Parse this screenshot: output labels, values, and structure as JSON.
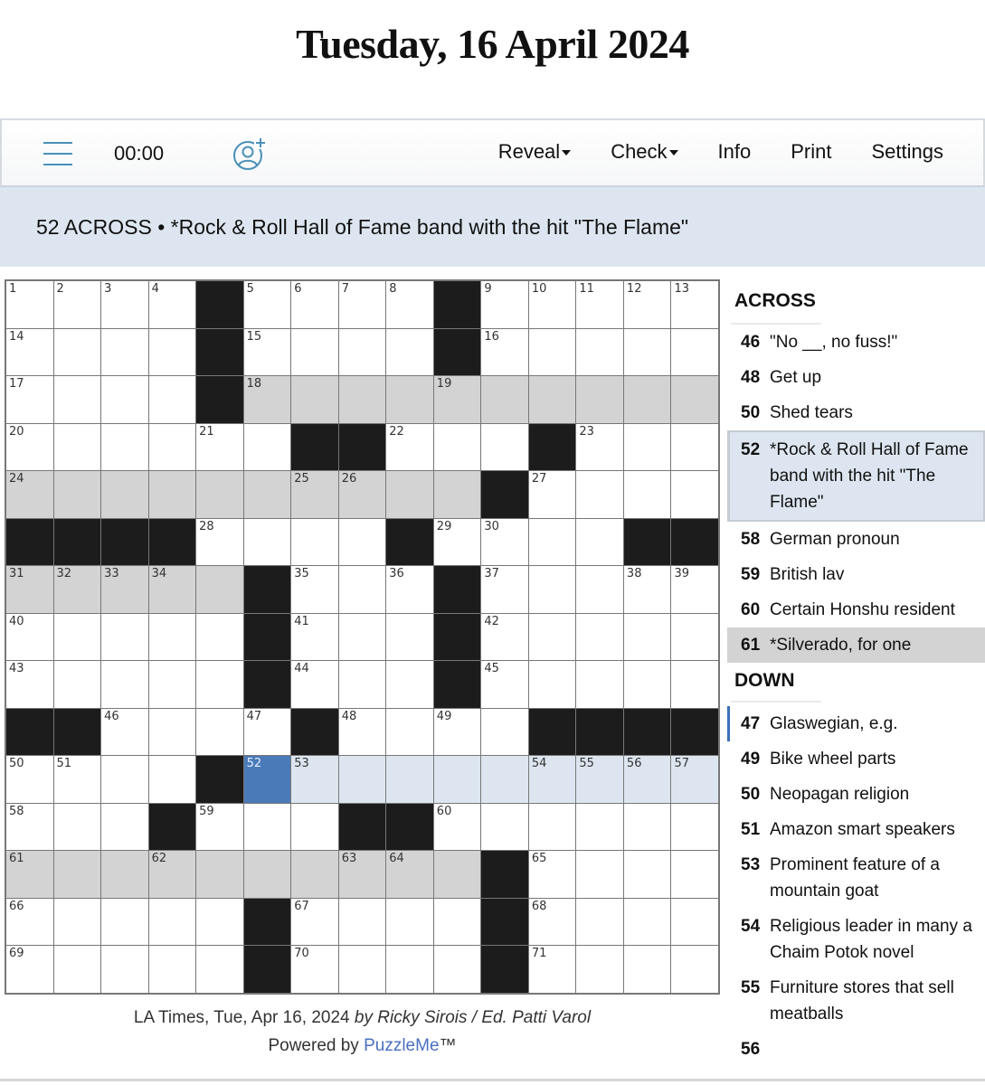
{
  "page": {
    "title": "Tuesday, 16 April 2024"
  },
  "toolbar": {
    "timer": "00:00",
    "menu": [
      {
        "label": "Reveal",
        "dropdown": true
      },
      {
        "label": "Check",
        "dropdown": true
      },
      {
        "label": "Info",
        "dropdown": false
      },
      {
        "label": "Print",
        "dropdown": false
      },
      {
        "label": "Settings",
        "dropdown": false
      }
    ],
    "icons": {
      "menu": "hamburger-icon",
      "add_player": "add-user-icon"
    }
  },
  "current_clue": {
    "text": "52 ACROSS • *Rock & Roll Hall of Fame band with the hit \"The Flame\""
  },
  "grid": {
    "size": 15,
    "selected_cell": "52",
    "rows": [
      "....#....#.....",
      "....#....#.....",
      "....#gggggggggg",
      "......##...#...",
      "gggggggggg#....",
      "####....#....##",
      "ggggg#...#.....",
      ".....#...#.....",
      ".....#...#.....",
      "##....#....####",
      "....#sbbbbbbbbb",
      "...#...##......",
      "gggggggggg#....",
      ".....#....#....",
      ".....#....#...."
    ],
    "legend": {
      "#": "black",
      ".": "empty",
      "g": "theme-highlight",
      "b": "current-word",
      "s": "selected"
    },
    "numbers": [
      [
        0,
        0,
        1
      ],
      [
        0,
        1,
        2
      ],
      [
        0,
        2,
        3
      ],
      [
        0,
        3,
        4
      ],
      [
        0,
        5,
        5
      ],
      [
        0,
        6,
        6
      ],
      [
        0,
        7,
        7
      ],
      [
        0,
        8,
        8
      ],
      [
        0,
        10,
        9
      ],
      [
        0,
        11,
        10
      ],
      [
        0,
        12,
        11
      ],
      [
        0,
        13,
        12
      ],
      [
        0,
        14,
        13
      ],
      [
        1,
        0,
        14
      ],
      [
        1,
        5,
        15
      ],
      [
        1,
        10,
        16
      ],
      [
        2,
        0,
        17
      ],
      [
        2,
        5,
        18
      ],
      [
        2,
        9,
        19
      ],
      [
        3,
        0,
        20
      ],
      [
        3,
        4,
        21
      ],
      [
        3,
        8,
        22
      ],
      [
        3,
        12,
        23
      ],
      [
        4,
        0,
        24
      ],
      [
        4,
        6,
        25
      ],
      [
        4,
        7,
        26
      ],
      [
        4,
        11,
        27
      ],
      [
        5,
        4,
        28
      ],
      [
        5,
        9,
        29
      ],
      [
        5,
        10,
        30
      ],
      [
        6,
        0,
        31
      ],
      [
        6,
        1,
        32
      ],
      [
        6,
        2,
        33
      ],
      [
        6,
        3,
        34
      ],
      [
        6,
        6,
        35
      ],
      [
        6,
        8,
        36
      ],
      [
        6,
        10,
        37
      ],
      [
        6,
        13,
        38
      ],
      [
        6,
        14,
        39
      ],
      [
        7,
        0,
        40
      ],
      [
        7,
        6,
        41
      ],
      [
        7,
        10,
        42
      ],
      [
        8,
        0,
        43
      ],
      [
        8,
        6,
        44
      ],
      [
        8,
        10,
        45
      ],
      [
        9,
        2,
        46
      ],
      [
        9,
        5,
        47
      ],
      [
        9,
        7,
        48
      ],
      [
        9,
        9,
        49
      ],
      [
        10,
        0,
        50
      ],
      [
        10,
        1,
        51
      ],
      [
        10,
        5,
        52
      ],
      [
        10,
        6,
        53
      ],
      [
        10,
        11,
        54
      ],
      [
        10,
        12,
        55
      ],
      [
        10,
        13,
        56
      ],
      [
        10,
        14,
        57
      ],
      [
        11,
        0,
        58
      ],
      [
        11,
        4,
        59
      ],
      [
        11,
        9,
        60
      ],
      [
        12,
        0,
        61
      ],
      [
        12,
        3,
        62
      ],
      [
        12,
        7,
        63
      ],
      [
        12,
        8,
        64
      ],
      [
        12,
        11,
        65
      ],
      [
        13,
        0,
        66
      ],
      [
        13,
        6,
        67
      ],
      [
        13,
        11,
        68
      ],
      [
        14,
        0,
        69
      ],
      [
        14,
        6,
        70
      ],
      [
        14,
        11,
        71
      ]
    ]
  },
  "credits": {
    "source": "LA Times, Tue, Apr 16, 2024",
    "byline": "by Ricky Sirois / Ed. Patti Varol",
    "powered_prefix": "Powered by",
    "powered_link": "PuzzleMe",
    "powered_suffix": "™"
  },
  "clues": {
    "across_heading": "ACROSS",
    "down_heading": "DOWN",
    "across": [
      {
        "num": "46",
        "text": "\"No __, no fuss!\"",
        "state": ""
      },
      {
        "num": "48",
        "text": "Get up",
        "state": ""
      },
      {
        "num": "50",
        "text": "Shed tears",
        "state": ""
      },
      {
        "num": "52",
        "text": "*Rock & Roll Hall of Fame band with the hit \"The Flame\"",
        "state": "active"
      },
      {
        "num": "58",
        "text": "German pronoun",
        "state": ""
      },
      {
        "num": "59",
        "text": "British lav",
        "state": ""
      },
      {
        "num": "60",
        "text": "Certain Honshu resident",
        "state": ""
      },
      {
        "num": "61",
        "text": "*Silverado, for one",
        "state": "cross"
      }
    ],
    "down": [
      {
        "num": "47",
        "text": "Glaswegian, e.g.",
        "state": "down-cur"
      },
      {
        "num": "49",
        "text": "Bike wheel parts",
        "state": ""
      },
      {
        "num": "50",
        "text": "Neopagan religion",
        "state": ""
      },
      {
        "num": "51",
        "text": "Amazon smart speakers",
        "state": ""
      },
      {
        "num": "53",
        "text": "Prominent feature of a mountain goat",
        "state": ""
      },
      {
        "num": "54",
        "text": "Religious leader in many a Chaim Potok novel",
        "state": ""
      },
      {
        "num": "55",
        "text": "Furniture stores that sell meatballs",
        "state": ""
      },
      {
        "num": "56",
        "text": "",
        "state": ""
      }
    ]
  },
  "colors": {
    "selected_cell": "#4a7ab8",
    "word_highlight": "#dde6f0",
    "theme_grey": "#d3d3d3",
    "black_square": "#1c1c1c",
    "icon_accent": "#4a90b8",
    "link": "#4a6fc0"
  }
}
